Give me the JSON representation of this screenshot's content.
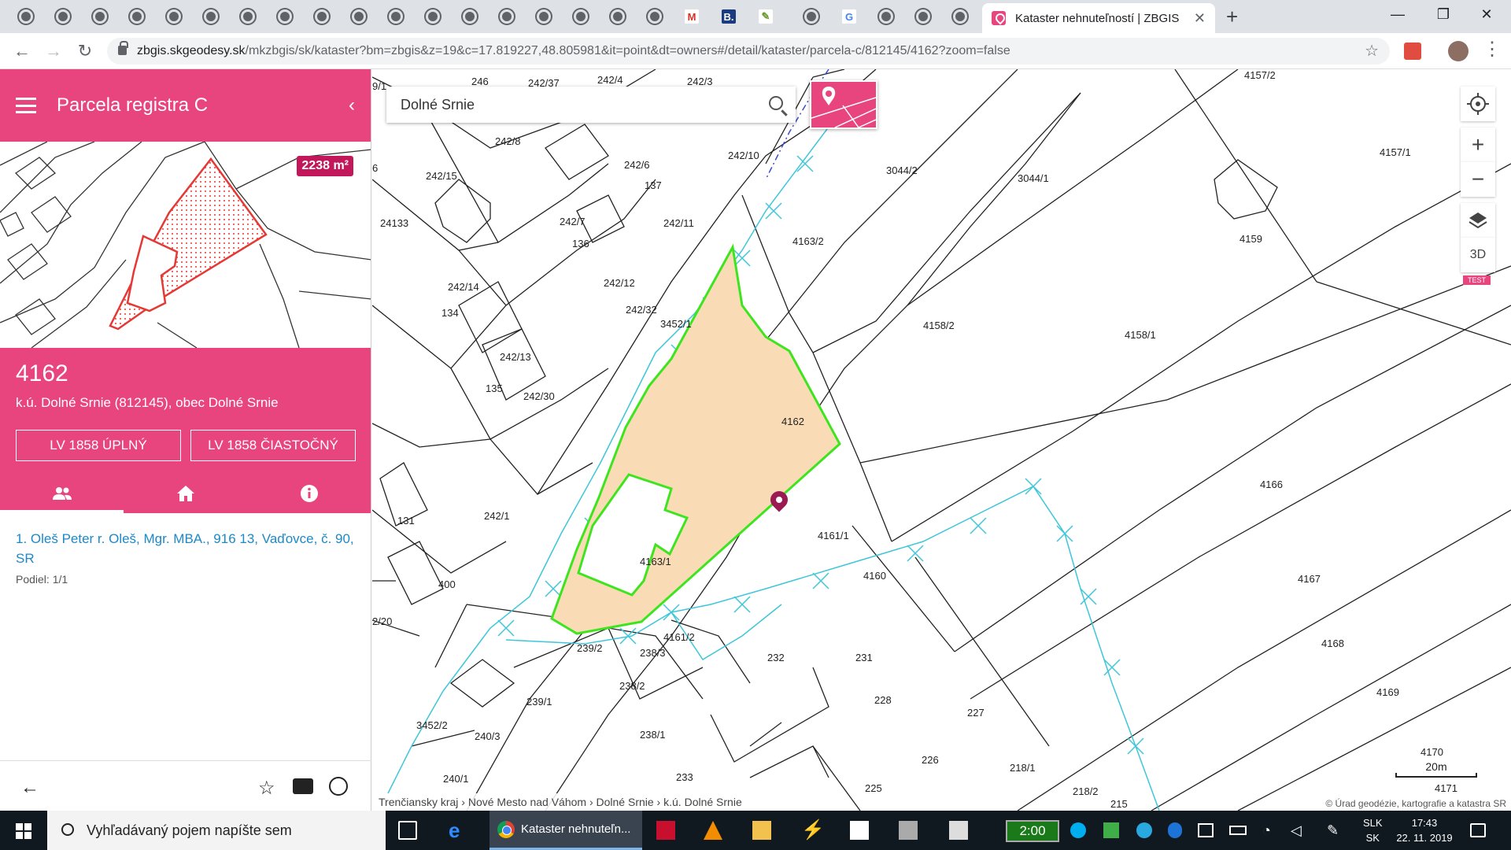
{
  "browser": {
    "active_tab_title": "Kataster nehnuteľností | ZBGIS",
    "url_host": "zbgis.skgeodesy.sk",
    "url_path": "/mkzbgis/sk/kataster?bm=zbgis&z=19&c=17.819227,48.805981&it=point&dt=owners#/detail/kataster/parcela-c/812145/4162?zoom=false"
  },
  "panel": {
    "title": "Parcela registra C",
    "area_badge": "2238 m²",
    "parcel_number": "4162",
    "parcel_subtitle": "k.ú. Dolné Srnie (812145), obec Dolné Srnie",
    "lv_full_label": "LV 1858 ÚPLNÝ",
    "lv_partial_label": "LV 1858 ČIASTOČNÝ",
    "tabs": [
      {
        "icon": "owners-icon",
        "active": true
      },
      {
        "icon": "home-icon",
        "active": false
      },
      {
        "icon": "info-icon",
        "active": false
      }
    ],
    "owner": {
      "name": "1. Oleš Peter r. Oleš, Mgr. MBA., 916 13, Vaďovce, č. 90, SR",
      "share": "Podiel: 1/1"
    }
  },
  "map": {
    "search_value": "Dolné Srnie",
    "control_3d_label": "3D",
    "test_badge": "TEST",
    "scale_label": "20m",
    "breadcrumb": [
      "Trenčiansky kraj",
      "Nové Mesto nad Váhom",
      "Dolné Srnie",
      "k.ú. Dolné Srnie"
    ],
    "copyright": "© Úrad geodézie, kartografie a katastra SR",
    "parcel_labels": [
      "246",
      "242/37",
      "242/4",
      "242/3",
      "242/8",
      "242/15",
      "242/6",
      "137",
      "242/10",
      "3044/2",
      "3044/1",
      "4157/2",
      "4157/1",
      "242/7",
      "136",
      "242/11",
      "4163/2",
      "4159",
      "242/14",
      "134",
      "242/12",
      "242/32",
      "3452/1",
      "4158/2",
      "4158/1",
      "242/13",
      "135",
      "242/30",
      "4162",
      "131",
      "242/1",
      "4166",
      "400",
      "4163/1",
      "4161/1",
      "4160",
      "4167",
      "2/20",
      "4161/2",
      "239/2",
      "238/3",
      "232",
      "231",
      "4168",
      "239/1",
      "238/2",
      "228",
      "227",
      "4169",
      "3452/2",
      "240/3",
      "238/1",
      "226",
      "218/1",
      "4170",
      "240/1",
      "233",
      "225",
      "218/2",
      "4171",
      "215",
      "6",
      "9/1",
      "24133"
    ],
    "colors": {
      "selected_fill": "#f9dcb5",
      "selected_stroke": "#3ee51f",
      "waterline": "#3ec6d9",
      "accent": "#e8447e"
    }
  },
  "taskbar": {
    "search_placeholder": "Vyhľadávaný pojem napíšte sem",
    "chrome_task_label": "Kataster nehnuteľn...",
    "clock_app": "2:00",
    "lang_1": "SLK",
    "lang_2": "SK",
    "time": "17:43",
    "date": "22. 11. 2019"
  }
}
